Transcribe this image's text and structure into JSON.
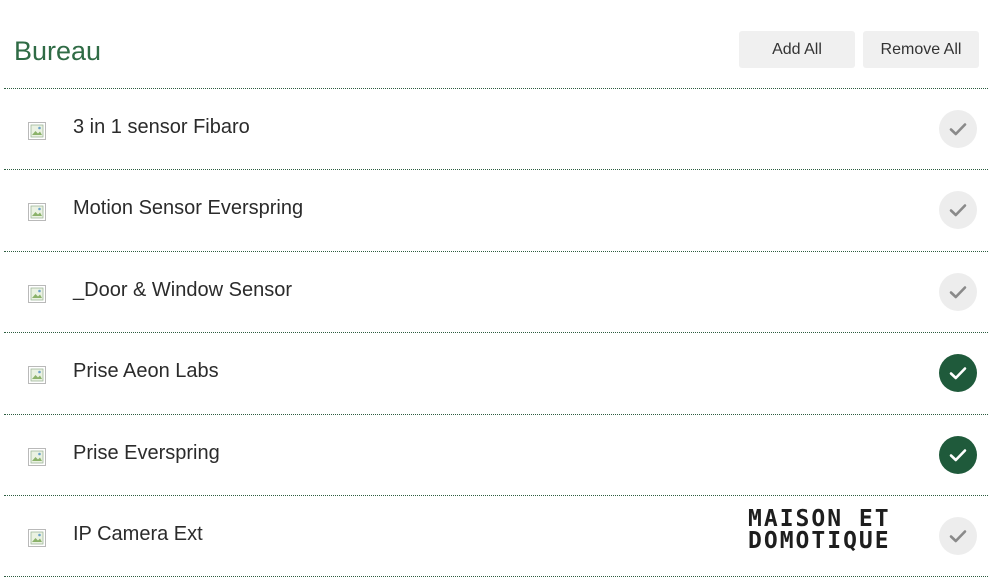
{
  "header": {
    "title": "Bureau",
    "add_all_label": "Add All",
    "remove_all_label": "Remove All"
  },
  "devices": [
    {
      "name": "3 in 1 sensor Fibaro",
      "selected": false
    },
    {
      "name": "Motion Sensor Everspring",
      "selected": false
    },
    {
      "name": "_Door & Window Sensor",
      "selected": false
    },
    {
      "name": "Prise Aeon Labs",
      "selected": true
    },
    {
      "name": "Prise Everspring",
      "selected": true
    },
    {
      "name": "IP Camera Ext",
      "selected": false
    }
  ],
  "watermark": {
    "line1": "MAISON ET",
    "line2": "DOMOTIQUE"
  },
  "colors": {
    "title": "#2f6b45",
    "check_on": "#1f5a3b",
    "check_off": "#ededed",
    "divider": "#2d5d40"
  },
  "icons": {
    "device": "broken-image-icon",
    "check": "checkmark-icon"
  }
}
